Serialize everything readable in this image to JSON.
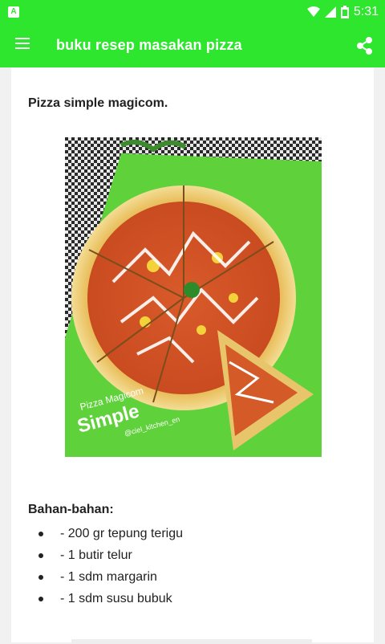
{
  "status_bar": {
    "left_icon_letter": "A",
    "time": "5:31",
    "icons": [
      "wifi-icon",
      "signal-icon",
      "battery-icon"
    ]
  },
  "app_bar": {
    "title": "buku resep masakan pizza",
    "menu_icon": "hamburger-menu-icon",
    "share_icon": "share-icon",
    "background": "#2ee62e"
  },
  "recipe": {
    "title": "Pizza simple magicom.",
    "photo_caption_small": "Pizza Magicom",
    "photo_caption_big": "Simple",
    "photo_handle": "@ciel_kitchen_en",
    "ingredients_heading": "Bahan-bahan:",
    "ingredients": [
      "- 200 gr tepung terigu",
      "- 1 butir telur",
      "- 1 sdm margarin",
      "- 1 sdm susu bubuk"
    ]
  }
}
